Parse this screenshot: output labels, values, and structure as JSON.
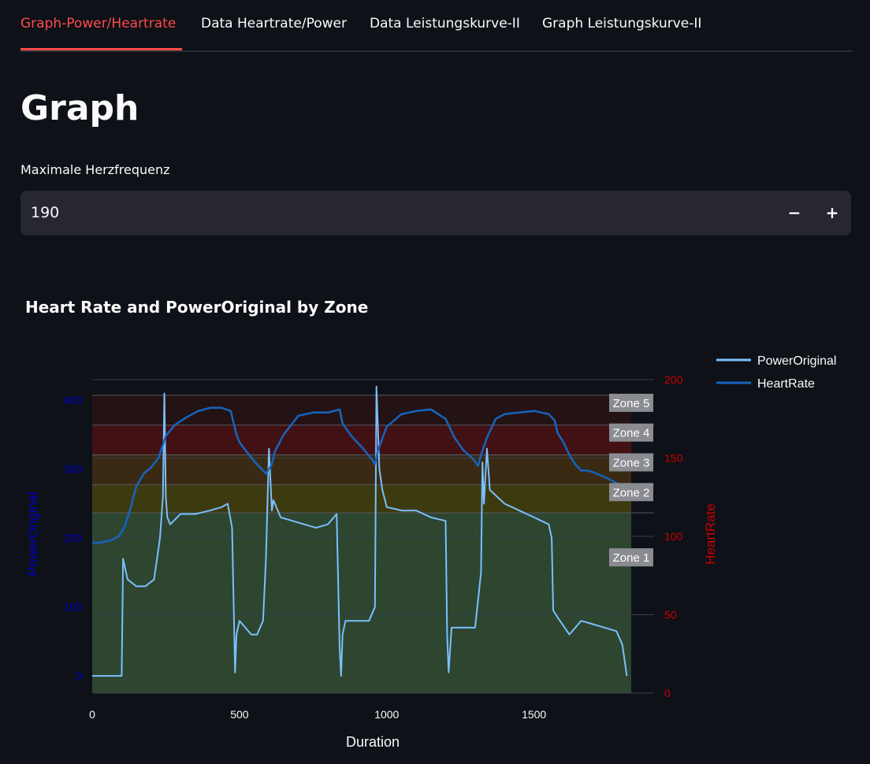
{
  "tabs": [
    {
      "label": "Graph-Power/Heartrate",
      "active": true
    },
    {
      "label": "Data Heartrate/Power",
      "active": false
    },
    {
      "label": "Data Leistungskurve-II",
      "active": false
    },
    {
      "label": "Graph Leistungskurve-II",
      "active": false
    }
  ],
  "page": {
    "title": "Graph"
  },
  "max_hr": {
    "label": "Maximale Herzfrequenz",
    "value": "190",
    "decrement": "−",
    "increment": "+"
  },
  "chart_data": {
    "type": "line",
    "title": "Heart Rate and PowerOriginal by Zone",
    "xlabel": "Duration",
    "ylabel_left": "PowerOriginal",
    "ylabel_right": "HeartRate",
    "x_ticks": [
      "0",
      "500",
      "1000",
      "1500"
    ],
    "x_tick_values": [
      0,
      500,
      1000,
      1500
    ],
    "y_left_ticks": [
      "0",
      "100",
      "200",
      "300",
      "400"
    ],
    "y_left_tick_values": [
      0,
      100,
      200,
      300,
      400
    ],
    "y_right_ticks": [
      "0",
      "50",
      "100",
      "150",
      "200"
    ],
    "y_right_tick_values": [
      0,
      50,
      100,
      150,
      200
    ],
    "xlim": [
      0,
      1830
    ],
    "ylim_left": [
      -25,
      430
    ],
    "ylim_right": [
      0,
      200
    ],
    "legend_position": "top-right",
    "colors": {
      "power": "#79c0ff",
      "heartrate": "#1565c0",
      "left_axis": "#0000cc",
      "right_axis": "#cc0000"
    },
    "zones": [
      {
        "label": "Zone 1",
        "y0": 0,
        "y1": 115,
        "color": "#2e4530"
      },
      {
        "label": "Zone 2",
        "y0": 115,
        "y1": 133,
        "color": "#3e3a10"
      },
      {
        "label": "Zone 3",
        "y0": 133,
        "y1": 152,
        "color": "#3a2a14"
      },
      {
        "label": "Zone 4",
        "y0": 152,
        "y1": 171,
        "color": "#421114"
      },
      {
        "label": "Zone 5",
        "y0": 171,
        "y1": 190,
        "color": "#241314"
      }
    ],
    "series": [
      {
        "name": "PowerOriginal",
        "axis": "left",
        "x": [
          0,
          20,
          40,
          60,
          80,
          100,
          105,
          120,
          150,
          180,
          210,
          230,
          240,
          245,
          250,
          255,
          265,
          300,
          350,
          400,
          440,
          460,
          475,
          485,
          490,
          500,
          520,
          540,
          560,
          570,
          580,
          590,
          600,
          610,
          615,
          640,
          680,
          720,
          760,
          800,
          830,
          840,
          845,
          850,
          860,
          900,
          940,
          960,
          965,
          975,
          985,
          1000,
          1050,
          1100,
          1150,
          1200,
          1205,
          1210,
          1220,
          1250,
          1280,
          1300,
          1320,
          1325,
          1330,
          1340,
          1350,
          1400,
          1450,
          1500,
          1550,
          1560,
          1565,
          1580,
          1620,
          1660,
          1700,
          1740,
          1780,
          1800,
          1815
        ],
        "y": [
          0,
          0,
          0,
          0,
          0,
          0,
          170,
          140,
          130,
          130,
          140,
          200,
          260,
          410,
          260,
          230,
          220,
          235,
          235,
          240,
          245,
          250,
          215,
          5,
          60,
          80,
          70,
          60,
          60,
          70,
          80,
          170,
          330,
          240,
          255,
          230,
          225,
          220,
          215,
          220,
          235,
          40,
          0,
          60,
          80,
          80,
          80,
          100,
          420,
          300,
          270,
          245,
          240,
          240,
          230,
          225,
          60,
          5,
          70,
          70,
          70,
          70,
          150,
          310,
          250,
          330,
          270,
          250,
          240,
          230,
          220,
          200,
          95,
          85,
          60,
          80,
          75,
          70,
          65,
          45,
          0
        ]
      },
      {
        "name": "HeartRate",
        "axis": "right",
        "x": [
          0,
          30,
          50,
          70,
          90,
          110,
          130,
          150,
          175,
          200,
          225,
          250,
          280,
          320,
          360,
          400,
          440,
          470,
          490,
          500,
          520,
          550,
          590,
          610,
          620,
          650,
          700,
          750,
          800,
          840,
          850,
          880,
          920,
          950,
          960,
          970,
          1000,
          1050,
          1100,
          1150,
          1200,
          1230,
          1260,
          1290,
          1310,
          1320,
          1340,
          1370,
          1400,
          1450,
          1500,
          1550,
          1570,
          1580,
          1600,
          1620,
          1640,
          1660,
          1680,
          1700,
          1750,
          1790,
          1800,
          1815
        ],
        "y": [
          96,
          96,
          97,
          98,
          100,
          106,
          118,
          132,
          140,
          144,
          150,
          164,
          171,
          176,
          180,
          182,
          182,
          180,
          165,
          160,
          155,
          148,
          140,
          146,
          154,
          165,
          177,
          179,
          179,
          181,
          172,
          164,
          156,
          149,
          146,
          155,
          170,
          178,
          180,
          181,
          175,
          163,
          155,
          150,
          145,
          152,
          163,
          175,
          178,
          179,
          180,
          178,
          174,
          166,
          160,
          152,
          146,
          142,
          142,
          141,
          137,
          133,
          130,
          129
        ]
      }
    ]
  }
}
